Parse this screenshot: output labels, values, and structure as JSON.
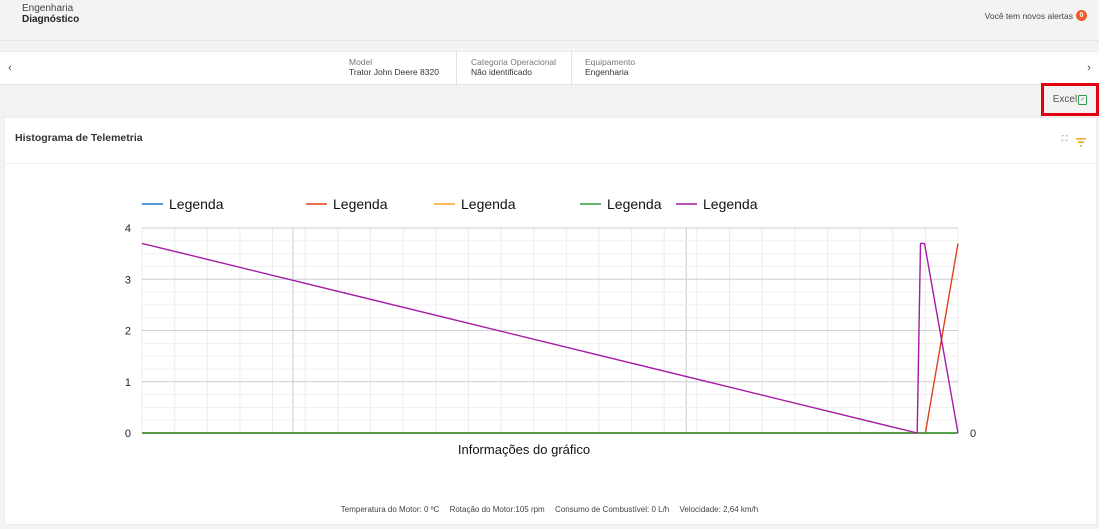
{
  "header": {
    "breadcrumb_parent": "Engenharia",
    "breadcrumb_current": "Diagnóstico",
    "alerts_text": "Você tem novos alertas",
    "alerts_count": "0"
  },
  "infobar": {
    "model_label": "Model",
    "model_value": "Trator John Deere 8320",
    "category_label": "Categoria Operacional",
    "category_value": "Não identificado",
    "equipment_label": "Equipamento",
    "equipment_value": "Engenharia",
    "nav_prev_icon": "chevron-left-icon",
    "nav_next_icon": "chevron-right-icon"
  },
  "toolbar": {
    "excel_label": "Excel",
    "excel_icon": "excel-file-icon"
  },
  "card": {
    "title": "Histograma de Telemetria",
    "expand_icon": "expand-icon",
    "filter_icon": "filter-icon"
  },
  "colors": {
    "series_blue": "#1f77d4",
    "series_red": "#e0421f",
    "series_orange": "#f5a623",
    "series_green": "#2e9e3e",
    "series_purple": "#a61aa6",
    "accent_alert": "#f05a28",
    "excel_green": "#2e9e4e",
    "highlight_red": "#e3000f"
  },
  "chart_data": {
    "type": "line",
    "xlabel": "Informações do gráfico",
    "ylabel": "",
    "ylim": [
      0,
      4
    ],
    "y_ticks": [
      "0",
      "1",
      "2",
      "3",
      "4"
    ],
    "right_axis_label": "0",
    "legend_position": "top",
    "grid": true,
    "x_count": 100,
    "series": [
      {
        "name": "Legenda",
        "color": "#1f77d4",
        "points": [
          [
            0,
            0
          ],
          [
            100,
            0
          ]
        ]
      },
      {
        "name": "Legenda",
        "color": "#e0421f",
        "points": [
          [
            0,
            0
          ],
          [
            96,
            0
          ],
          [
            100,
            3.7
          ]
        ]
      },
      {
        "name": "Legenda",
        "color": "#f5a623",
        "points": [
          [
            0,
            0
          ],
          [
            100,
            0
          ]
        ]
      },
      {
        "name": "Legenda",
        "color": "#2e9e3e",
        "points": [
          [
            0,
            0
          ],
          [
            100,
            0
          ]
        ]
      },
      {
        "name": "Legenda",
        "color": "#a61aa6",
        "points": [
          [
            0,
            3.7
          ],
          [
            95,
            0
          ],
          [
            95.4,
            3.7
          ],
          [
            95.9,
            3.7
          ],
          [
            100,
            0
          ]
        ]
      }
    ]
  },
  "footer": {
    "stats": [
      "Temperatura do Motor: 0 ºC",
      "Rotação do Motor:105 rpm",
      "Consumo de Combustível: 0 L/h",
      "Velocidade: 2,64 km/h"
    ]
  }
}
